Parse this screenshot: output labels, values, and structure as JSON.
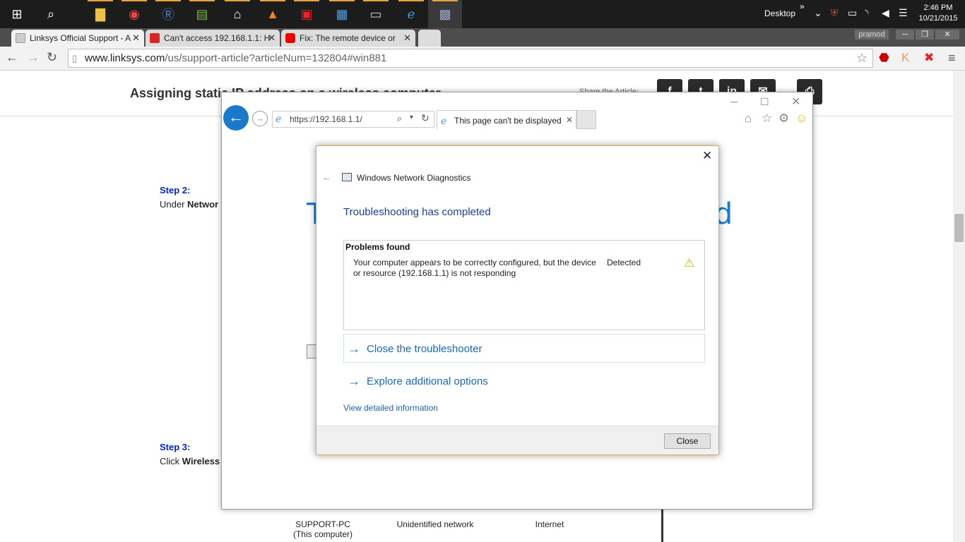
{
  "taskbar": {
    "desktop_label": "Desktop",
    "time": "2:46 PM",
    "date": "10/21/2015"
  },
  "browser": {
    "tabs": [
      {
        "label": "Linksys Official Support - A"
      },
      {
        "label": "Can't access 192.168.1.1: H"
      },
      {
        "label": "Fix: The remote device or"
      }
    ],
    "profile": "pramod",
    "url_host": "www.linksys.com",
    "url_path": "/us/support-article?articleNum=132804#win881"
  },
  "article": {
    "title": "Assigning static IP address on a wireless computer",
    "share_label": "Share the Article:",
    "step2_heading": "Step 2:",
    "step2_text_prefix": "Under",
    "step2_text_bold": "Networ",
    "step3_heading": "Step 3:",
    "step3_text_prefix": "Click",
    "step3_text_bold": "Wireless",
    "net_pc": "SUPPORT-PC",
    "net_pc_sub": "(This computer)",
    "net_unidentified": "Unidentified network",
    "net_internet": "Internet"
  },
  "ie": {
    "address": "https://192.168.1.1/",
    "tab_title": "This page can't be displayed",
    "big_text_left": "T",
    "big_text_right": "d"
  },
  "dialog": {
    "app_title": "Windows Network Diagnostics",
    "heading": "Troubleshooting has completed",
    "problems_header": "Problems found",
    "problem_text": "Your computer appears to be correctly configured, but the device or resource (192.168.1.1) is not responding",
    "problem_status": "Detected",
    "option_close": "Close the troubleshooter",
    "option_explore": "Explore additional options",
    "detail_link": "View detailed information",
    "close_button": "Close"
  },
  "colors": {
    "accent": "#1979ca",
    "link": "#1967c2",
    "step_heading": "#0026c9",
    "dialog_border": "#e2a84c"
  }
}
